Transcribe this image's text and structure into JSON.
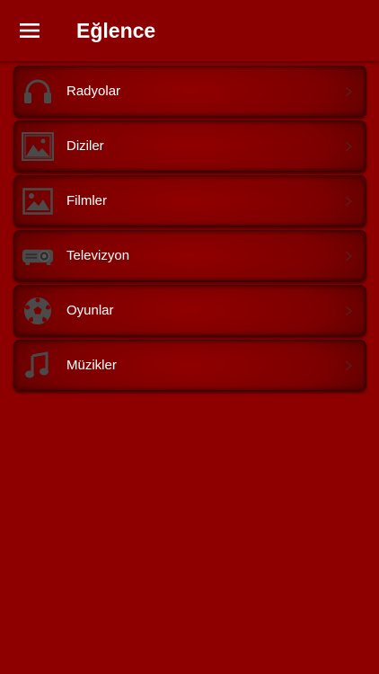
{
  "header": {
    "title": "Eğlence",
    "menu_icon": "hamburger-icon"
  },
  "menu": {
    "items": [
      {
        "label": "Radyolar",
        "icon": "headphones-icon"
      },
      {
        "label": "Diziler",
        "icon": "image-frame-icon"
      },
      {
        "label": "Filmler",
        "icon": "picture-icon"
      },
      {
        "label": "Televizyon",
        "icon": "projector-icon"
      },
      {
        "label": "Oyunlar",
        "icon": "soccer-ball-icon"
      },
      {
        "label": "Müzikler",
        "icon": "music-note-icon"
      }
    ]
  },
  "colors": {
    "background": "#8e0000",
    "appbar": "#8a0000",
    "icon": "#4a4a4a",
    "chevron": "#5a1a1a",
    "text": "#ffffff"
  }
}
